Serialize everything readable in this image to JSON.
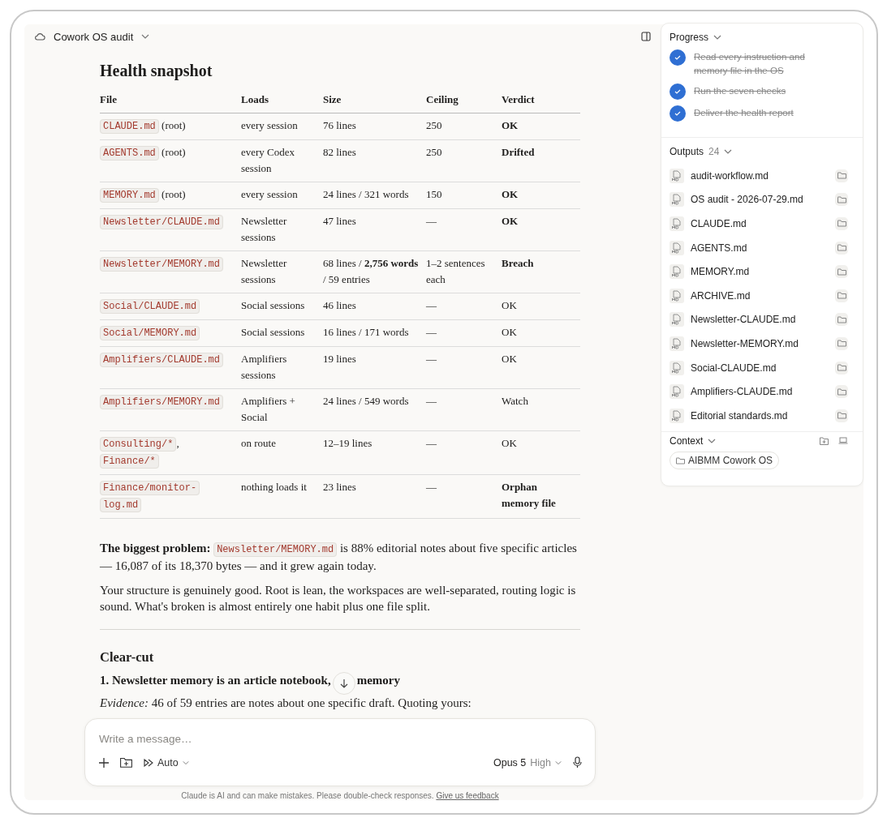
{
  "chat_title": "Cowork OS audit",
  "report": {
    "heading": "Health snapshot",
    "table": {
      "columns": [
        "File",
        "Loads",
        "Size",
        "Ceiling",
        "Verdict"
      ],
      "rows": [
        {
          "file": [
            {
              "kind": "code",
              "text": "CLAUDE.md"
            },
            {
              "kind": "text",
              "text": " (root)"
            }
          ],
          "loads": "every session",
          "size": "76 lines",
          "ceiling": "250",
          "verdict": "OK",
          "bold": true
        },
        {
          "file": [
            {
              "kind": "code",
              "text": "AGENTS.md"
            },
            {
              "kind": "text",
              "text": " (root)"
            }
          ],
          "loads": "every Codex session",
          "size": "82 lines",
          "ceiling": "250",
          "verdict": "Drifted",
          "bold": true
        },
        {
          "file": [
            {
              "kind": "code",
              "text": "MEMORY.md"
            },
            {
              "kind": "text",
              "text": " (root)"
            }
          ],
          "loads": "every session",
          "size": "24 lines / 321 words",
          "ceiling": "150",
          "verdict": "OK",
          "bold": true
        },
        {
          "file": [
            {
              "kind": "code",
              "text": "Newsletter/CLAUDE.md"
            }
          ],
          "loads": "Newsletter sessions",
          "size": "47 lines",
          "ceiling": "—",
          "verdict": "OK",
          "bold": true
        },
        {
          "file": [
            {
              "kind": "code",
              "text": "Newsletter/MEMORY.md"
            }
          ],
          "loads": "Newsletter sessions",
          "size": "68 lines / **2,756 words** / 59 entries",
          "ceiling": "1–2 sentences each",
          "verdict": "Breach",
          "bold": true
        },
        {
          "file": [
            {
              "kind": "code",
              "text": "Social/CLAUDE.md"
            }
          ],
          "loads": "Social sessions",
          "size": "46 lines",
          "ceiling": "—",
          "verdict": "OK",
          "bold": false
        },
        {
          "file": [
            {
              "kind": "code",
              "text": "Social/MEMORY.md"
            }
          ],
          "loads": "Social sessions",
          "size": "16 lines / 171 words",
          "ceiling": "—",
          "verdict": "OK",
          "bold": false
        },
        {
          "file": [
            {
              "kind": "code",
              "text": "Amplifiers/CLAUDE.md"
            }
          ],
          "loads": "Amplifiers sessions",
          "size": "19 lines",
          "ceiling": "—",
          "verdict": "OK",
          "bold": false
        },
        {
          "file": [
            {
              "kind": "code",
              "text": "Amplifiers/MEMORY.md"
            }
          ],
          "loads": "Amplifiers + Social",
          "size": "24 lines / 549 words",
          "ceiling": "—",
          "verdict": "Watch",
          "bold": false
        },
        {
          "file": [
            {
              "kind": "code",
              "text": "Consulting/*"
            },
            {
              "kind": "text",
              "text": ", "
            },
            {
              "kind": "code",
              "text": "Finance/*"
            }
          ],
          "loads": "on route",
          "size": "12–19 lines",
          "ceiling": "—",
          "verdict": "OK",
          "bold": false
        },
        {
          "file": [
            {
              "kind": "code",
              "text": "Finance/monitor-log.md"
            }
          ],
          "loads": "nothing loads it",
          "size": "23 lines",
          "ceiling": "—",
          "verdict": "Orphan memory file",
          "bold": true
        }
      ]
    },
    "summary": [
      {
        "kind": "text",
        "text": "**The biggest problem:** "
      },
      {
        "kind": "code",
        "text": "Newsletter/MEMORY.md"
      },
      {
        "kind": "text",
        "text": " is 88% editorial notes about five specific articles — 16,087 of its 18,370 bytes — and it grew again today."
      }
    ],
    "verdict_text": "Your structure is genuinely good. Root is lean, the workspaces are well-separated, routing logic is sound. What's broken is almost entirely one habit plus one file split.",
    "section_heading": "Clear-cut",
    "item_title_start": "1. Newsletter memory is an article notebook,",
    "item_title_end": "memory",
    "evidence": "*Evidence:* 46 of 59 entries are notes about one specific draft. Quoting yours:"
  },
  "composer": {
    "placeholder": "Write a message…",
    "mode": "Auto",
    "model": "Opus 5",
    "effort": "High"
  },
  "disclaimer": {
    "text": "Claude is AI and can make mistakes. Please double-check responses.",
    "link": "Give us feedback"
  },
  "panel": {
    "progress": {
      "title": "Progress",
      "steps": [
        {
          "text": "Read every instruction and memory file in the OS",
          "done": true
        },
        {
          "text": "Run the seven checks",
          "done": true
        },
        {
          "text": "Deliver the health report",
          "done": true
        }
      ]
    },
    "outputs": {
      "title": "Outputs",
      "count": "24",
      "files": [
        "audit-workflow.md",
        "OS audit - 2026-07-29.md",
        "CLAUDE.md",
        "AGENTS.md",
        "MEMORY.md",
        "ARCHIVE.md",
        "Newsletter-CLAUDE.md",
        "Newsletter-MEMORY.md",
        "Social-CLAUDE.md",
        "Amplifiers-CLAUDE.md",
        "Editorial standards.md"
      ]
    },
    "context": {
      "title": "Context",
      "folders": [
        "AIBMM Cowork OS"
      ]
    }
  }
}
